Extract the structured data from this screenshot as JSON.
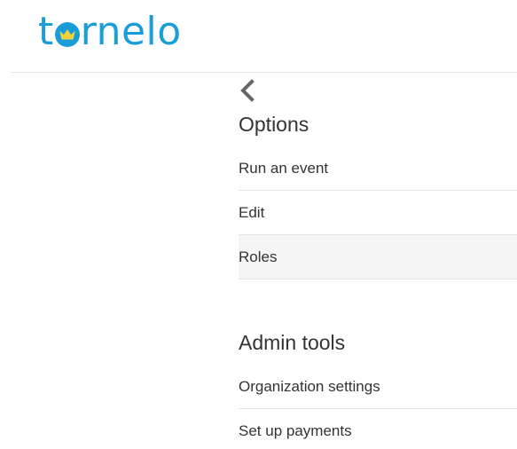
{
  "brand": {
    "logo_prefix": "t",
    "logo_suffix": "rnelo",
    "logo_icon": "crown-icon",
    "color": "#1a9ed9"
  },
  "navigation": {
    "back_icon": "chevron-left-icon"
  },
  "options": {
    "title": "Options",
    "items": [
      {
        "label": "Run an event"
      },
      {
        "label": "Edit"
      },
      {
        "label": "Roles",
        "active": true
      }
    ]
  },
  "admin_tools": {
    "title": "Admin tools",
    "items": [
      {
        "label": "Organization settings"
      },
      {
        "label": "Set up payments"
      }
    ]
  }
}
